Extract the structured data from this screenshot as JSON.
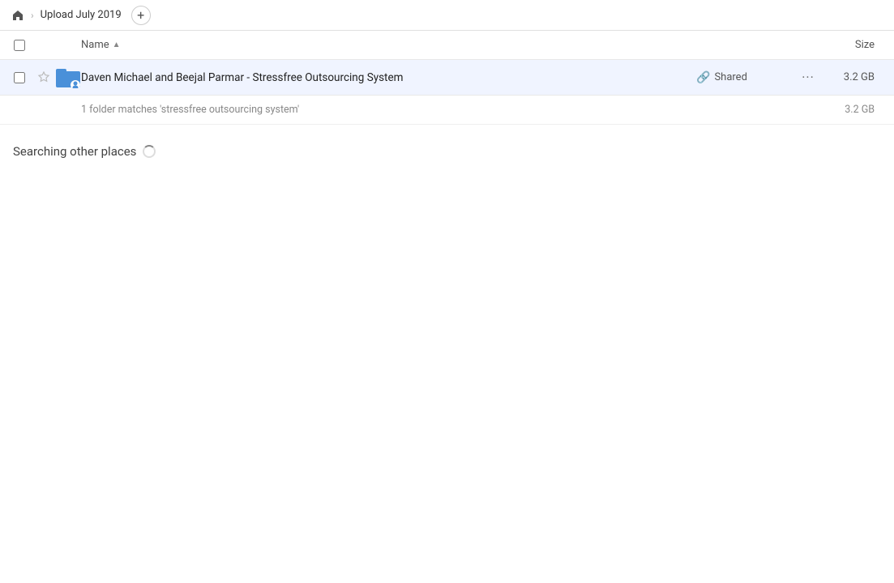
{
  "breadcrumb": {
    "home_label": "Home",
    "current_folder": "Upload July 2019",
    "add_label": "+"
  },
  "columns": {
    "name_label": "Name",
    "size_label": "Size"
  },
  "file_row": {
    "name": "Daven Michael and Beejal Parmar - Stressfree Outsourcing System",
    "shared_label": "Shared",
    "size": "3.2 GB",
    "more_label": "···"
  },
  "match_row": {
    "text": "1 folder matches 'stressfree outsourcing system'",
    "size": "3.2 GB"
  },
  "searching": {
    "label": "Searching other places"
  }
}
